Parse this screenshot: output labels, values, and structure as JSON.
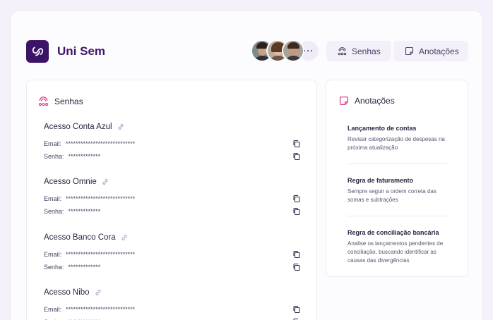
{
  "app": {
    "title": "Uni Sem"
  },
  "header": {
    "more_label": "···",
    "buttons": {
      "passwords": "Senhas",
      "notes": "Anotações"
    }
  },
  "colors": {
    "brand": "#3b1467",
    "accent": "#e0398a",
    "panel_bg": "#ffffff"
  },
  "passwords": {
    "title": "Senhas",
    "email_label": "Email:",
    "password_label": "Senha:",
    "entries": [
      {
        "name": "Acesso Conta Azul",
        "email": "****************************",
        "password": "*************"
      },
      {
        "name": "Acesso Omnie",
        "email": "****************************",
        "password": "*************"
      },
      {
        "name": "Acesso Banco Cora",
        "email": "****************************",
        "password": "*************"
      },
      {
        "name": "Acesso Nibo",
        "email": "****************************",
        "password": "*************"
      }
    ]
  },
  "notes": {
    "title": "Anotações",
    "items": [
      {
        "title": "Lançamento de contas",
        "text": "Revisar categorização de despesas na próxima atualização"
      },
      {
        "title": "Regra de faturamento",
        "text": "Sempre seguir a ordem correta das somas e subtrações"
      },
      {
        "title": "Regra de conciliação bancária",
        "text": "Analise os lançamentos pendentes de conciliação, buscando identificar as causas das divergências"
      }
    ]
  }
}
